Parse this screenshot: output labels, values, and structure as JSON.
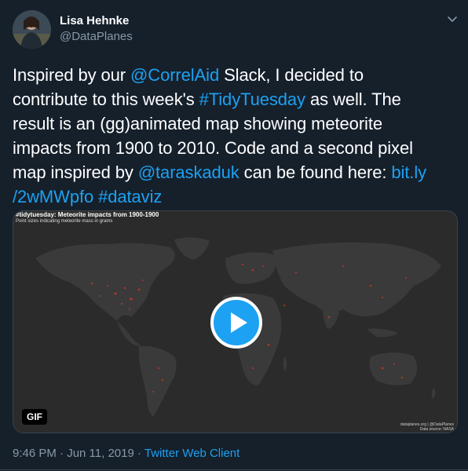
{
  "author": {
    "name": "Lisa Hehnke",
    "handle": "@DataPlanes"
  },
  "tweet": {
    "t1": "Inspired by our ",
    "mention1": "@CorrelAid",
    "t2": " Slack, I decided to",
    "t3": "contribute to this week's ",
    "hashtag1": "#TidyTuesday",
    "t4": " as well. The",
    "t5": "result is an (gg)animated map showing meteorite",
    "t6": "impacts from 1900 to 2010. Code and a second pixel",
    "t7": "map inspired by ",
    "mention2": "@taraskaduk",
    "t8": " can be found here: ",
    "link_a": "bit.ly",
    "link_b": "/2wMWpfo",
    "hashtag2": "#dataviz"
  },
  "media": {
    "map_title": "#tidytuesday: Meteorite impacts from 1900-1900",
    "map_subtitle": "Point sizes indicating meteorite mass in grams",
    "credit_line1": "dataplanes.org | @DataPlanes",
    "credit_line2": "Data source: NASA",
    "gif_label": "GIF",
    "play_icon": "play-icon"
  },
  "meta": {
    "timestamp": "9:46 PM · Jun 11, 2019 · ",
    "client": "Twitter Web Client"
  },
  "colors": {
    "background": "#15202b",
    "link": "#1da1f2",
    "secondary_text": "#8899a6",
    "map_background": "#2b2b2b",
    "meteorite_points": "#c0392b"
  }
}
